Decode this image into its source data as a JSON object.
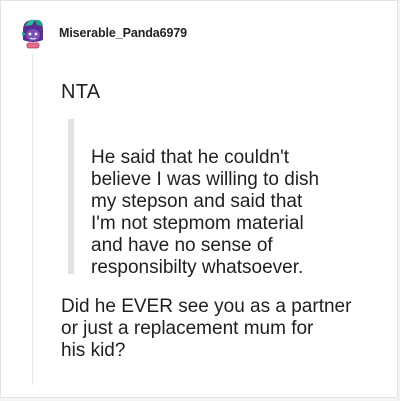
{
  "post": {
    "username": "Miserable_Panda6979",
    "avatar": "avatar-icon",
    "verdict": "NTA",
    "quote": "He said that he couldn't\nbelieve I was willing to dish\nmy stepson and said that\nI'm not stepmom material\nand have no sense of\nresponsibilty whatsoever.",
    "reply": "Did he EVER see you as a partner\nor just a replacement mum for\nhis kid?"
  },
  "colors": {
    "text": "#1f1f1f",
    "quote_bar": "#e3e3e3",
    "avatar_purple": "#5a2d91",
    "avatar_teal": "#2bbf9a"
  }
}
